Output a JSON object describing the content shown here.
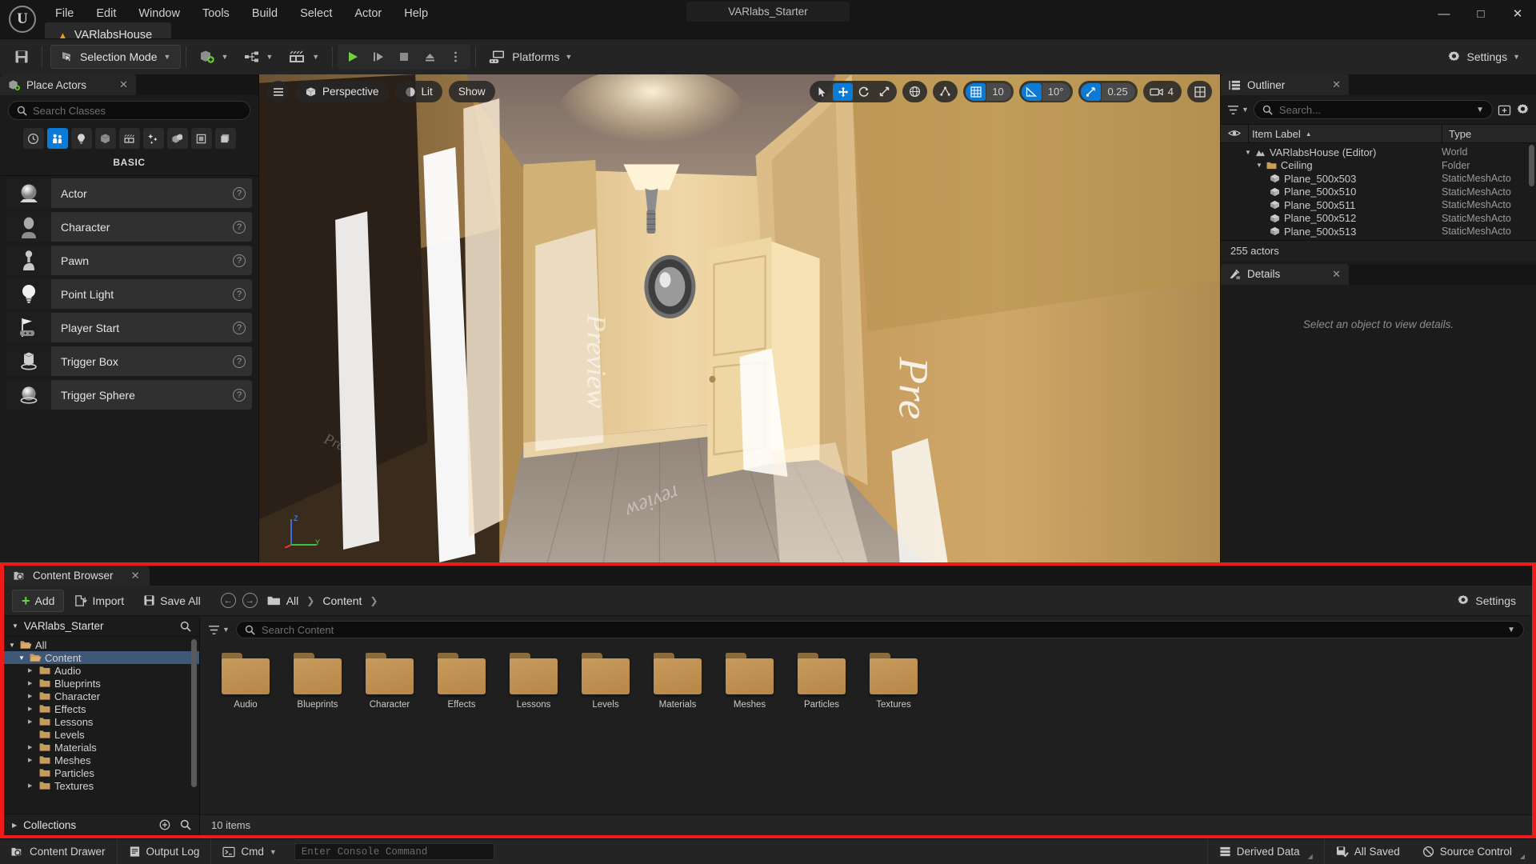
{
  "window": {
    "project_title": "VARlabs_Starter",
    "minimize": "—",
    "maximize": "□",
    "close": "✕"
  },
  "menubar": {
    "items": [
      "File",
      "Edit",
      "Window",
      "Tools",
      "Build",
      "Select",
      "Actor",
      "Help"
    ]
  },
  "level_tab": {
    "label": "VARlabsHouse"
  },
  "toolbar": {
    "selection_mode": "Selection Mode",
    "platforms": "Platforms",
    "settings": "Settings"
  },
  "place_actors": {
    "tab_label": "Place Actors",
    "search_placeholder": "Search Classes",
    "category_label": "BASIC",
    "categories": [
      "recent-icon",
      "basic-icon",
      "lights-icon",
      "shapes-icon",
      "cinematic-icon",
      "visual-effects-icon",
      "geometry-icon",
      "volumes-icon",
      "all-classes-icon"
    ],
    "items": [
      {
        "name": "Actor",
        "icon": "actor-sphere-icon",
        "help": "?"
      },
      {
        "name": "Character",
        "icon": "character-icon",
        "help": "?"
      },
      {
        "name": "Pawn",
        "icon": "pawn-icon",
        "help": "?"
      },
      {
        "name": "Point Light",
        "icon": "point-light-icon",
        "help": "?"
      },
      {
        "name": "Player Start",
        "icon": "player-start-icon",
        "help": "?"
      },
      {
        "name": "Trigger Box",
        "icon": "trigger-box-icon",
        "help": "?"
      },
      {
        "name": "Trigger Sphere",
        "icon": "trigger-sphere-icon",
        "help": "?"
      }
    ]
  },
  "viewport": {
    "menu_icon": "hamburger-icon",
    "perspective": "Perspective",
    "lit": "Lit",
    "show": "Show",
    "grid_snap_value": "10",
    "rotation_snap_value": "10°",
    "scale_snap_value": "0.25",
    "camera_speed_value": "4",
    "gizmos": [
      "select-icon",
      "move-icon",
      "rotate-icon",
      "scale-icon"
    ],
    "active_gizmo": "move-icon",
    "coord_icon": "globe-icon",
    "surface_snap_icon": "surface-snap-icon",
    "maximize_icon": "viewport-layout-icon",
    "axis_labels": {
      "z": "Z",
      "y": "Y"
    }
  },
  "outliner": {
    "tab_label": "Outliner",
    "search_placeholder": "Search...",
    "columns": {
      "item_label": "Item Label",
      "type": "Type",
      "sort_arrow": "▲"
    },
    "rows": [
      {
        "label": "VARlabsHouse (Editor)",
        "type": "World",
        "depth": 0,
        "icon": "world-icon",
        "expanded": true
      },
      {
        "label": "Ceiling",
        "type": "Folder",
        "depth": 1,
        "icon": "folder-icon",
        "expanded": true
      },
      {
        "label": "Plane_500x503",
        "type": "StaticMeshActo",
        "depth": 2,
        "icon": "static-mesh-icon"
      },
      {
        "label": "Plane_500x510",
        "type": "StaticMeshActo",
        "depth": 2,
        "icon": "static-mesh-icon"
      },
      {
        "label": "Plane_500x511",
        "type": "StaticMeshActo",
        "depth": 2,
        "icon": "static-mesh-icon"
      },
      {
        "label": "Plane_500x512",
        "type": "StaticMeshActo",
        "depth": 2,
        "icon": "static-mesh-icon"
      },
      {
        "label": "Plane_500x513",
        "type": "StaticMeshActo",
        "depth": 2,
        "icon": "static-mesh-icon"
      }
    ],
    "actor_count": "255 actors"
  },
  "details": {
    "tab_label": "Details",
    "empty_message": "Select an object to view details."
  },
  "content_browser": {
    "tab_label": "Content Browser",
    "add_label": "Add",
    "import_label": "Import",
    "save_all_label": "Save All",
    "settings_label": "Settings",
    "breadcrumbs": [
      "All",
      "Content"
    ],
    "tree_root": "VARlabs_Starter",
    "search_placeholder": "Search Content",
    "tree": [
      {
        "label": "All",
        "depth": 0,
        "expanded": true,
        "selected": false,
        "has_children": true
      },
      {
        "label": "Content",
        "depth": 1,
        "expanded": true,
        "selected": true,
        "has_children": true
      },
      {
        "label": "Audio",
        "depth": 2,
        "expanded": false,
        "selected": false,
        "has_children": true
      },
      {
        "label": "Blueprints",
        "depth": 2,
        "expanded": false,
        "selected": false,
        "has_children": true
      },
      {
        "label": "Character",
        "depth": 2,
        "expanded": false,
        "selected": false,
        "has_children": true
      },
      {
        "label": "Effects",
        "depth": 2,
        "expanded": false,
        "selected": false,
        "has_children": true
      },
      {
        "label": "Lessons",
        "depth": 2,
        "expanded": false,
        "selected": false,
        "has_children": true
      },
      {
        "label": "Levels",
        "depth": 2,
        "expanded": false,
        "selected": false,
        "has_children": false
      },
      {
        "label": "Materials",
        "depth": 2,
        "expanded": false,
        "selected": false,
        "has_children": true
      },
      {
        "label": "Meshes",
        "depth": 2,
        "expanded": false,
        "selected": false,
        "has_children": true
      },
      {
        "label": "Particles",
        "depth": 2,
        "expanded": false,
        "selected": false,
        "has_children": false
      },
      {
        "label": "Textures",
        "depth": 2,
        "expanded": false,
        "selected": false,
        "has_children": true
      }
    ],
    "collections_label": "Collections",
    "folders": [
      "Audio",
      "Blueprints",
      "Character",
      "Effects",
      "Lessons",
      "Levels",
      "Materials",
      "Meshes",
      "Particles",
      "Textures"
    ],
    "item_count": "10 items",
    "highlight_color": "#ef1b1b"
  },
  "statusbar": {
    "content_drawer": "Content Drawer",
    "output_log": "Output Log",
    "cmd": "Cmd",
    "console_placeholder": "Enter Console Command",
    "derived_data": "Derived Data",
    "all_saved": "All Saved",
    "source_control": "Source Control"
  },
  "colors": {
    "accent_blue": "#0c7bd6",
    "folder_gold": "#c79b5c",
    "play_green": "#6fd13f",
    "highlight_red": "#ef1b1b",
    "panel_bg": "#1b1b1b",
    "toolbar_bg": "#242424"
  }
}
